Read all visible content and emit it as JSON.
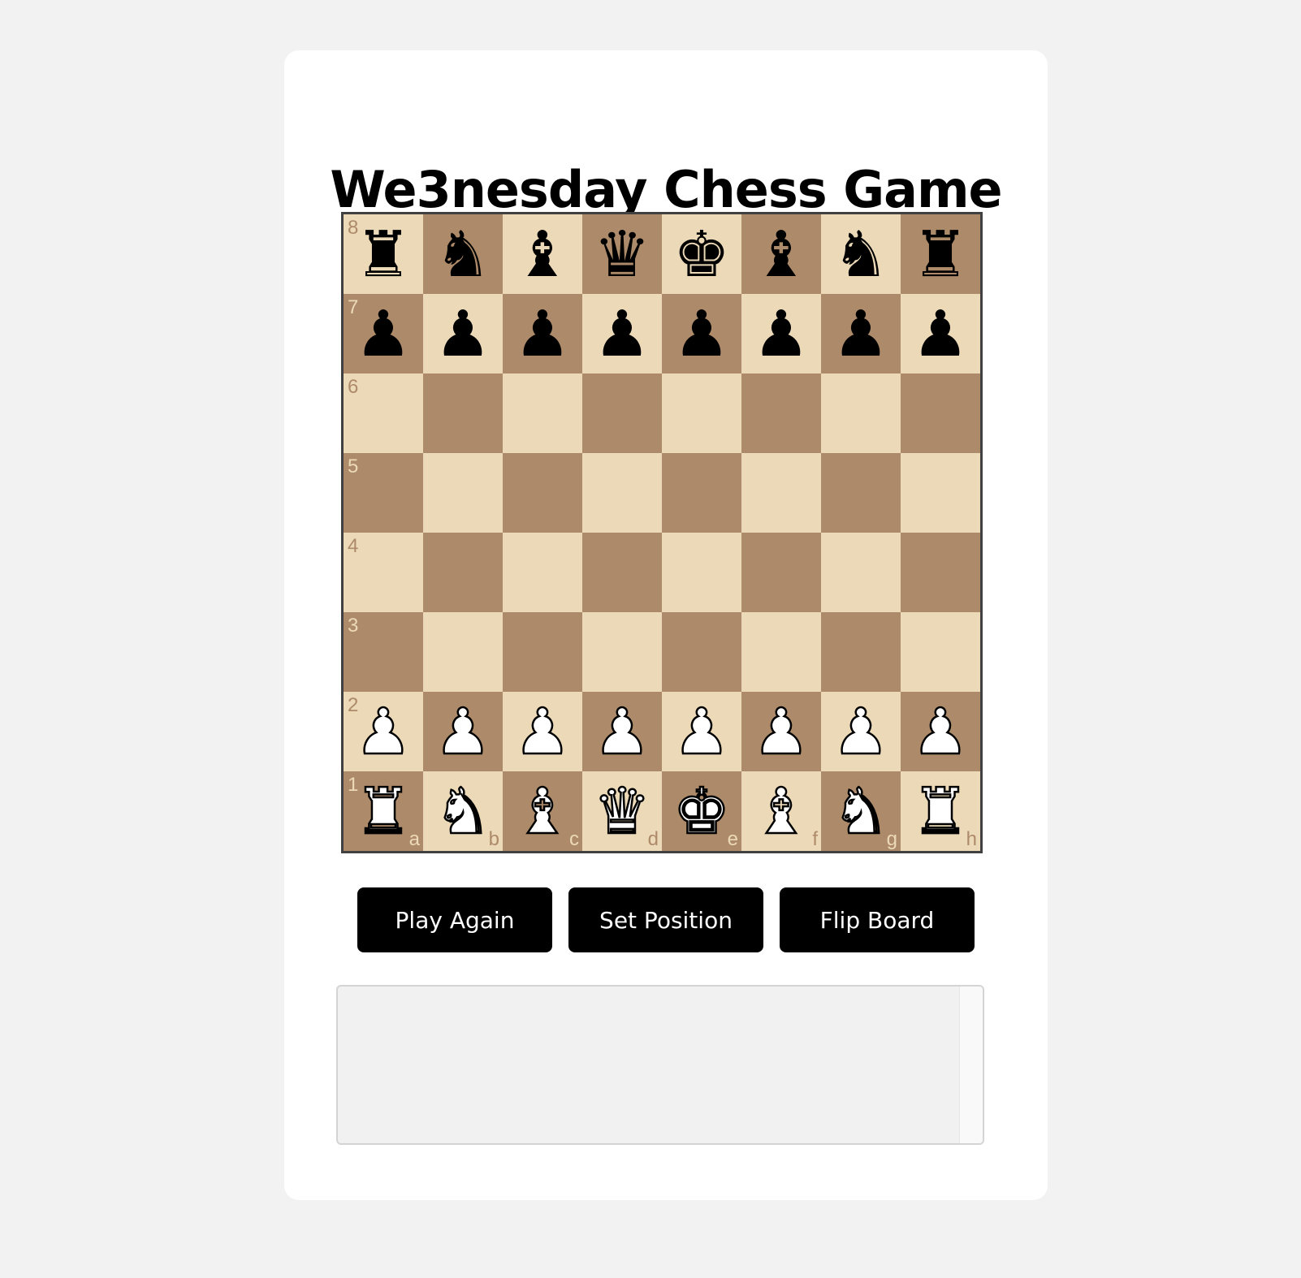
{
  "page": {
    "title": "We3nesday Chess Game"
  },
  "colors": {
    "light_square": "#ecd9b7",
    "dark_square": "#ad8a69",
    "button_bg": "#000000",
    "button_text": "#ffffff"
  },
  "board": {
    "files": [
      "a",
      "b",
      "c",
      "d",
      "e",
      "f",
      "g",
      "h"
    ],
    "ranks": [
      "8",
      "7",
      "6",
      "5",
      "4",
      "3",
      "2",
      "1"
    ],
    "position": [
      [
        "bR",
        "bN",
        "bB",
        "bQ",
        "bK",
        "bB",
        "bN",
        "bR"
      ],
      [
        "bP",
        "bP",
        "bP",
        "bP",
        "bP",
        "bP",
        "bP",
        "bP"
      ],
      [
        "",
        "",
        "",
        "",
        "",
        "",
        "",
        ""
      ],
      [
        "",
        "",
        "",
        "",
        "",
        "",
        "",
        ""
      ],
      [
        "",
        "",
        "",
        "",
        "",
        "",
        "",
        ""
      ],
      [
        "",
        "",
        "",
        "",
        "",
        "",
        "",
        ""
      ],
      [
        "wP",
        "wP",
        "wP",
        "wP",
        "wP",
        "wP",
        "wP",
        "wP"
      ],
      [
        "wR",
        "wN",
        "wB",
        "wQ",
        "wK",
        "wB",
        "wN",
        "wR"
      ]
    ],
    "piece_names": {
      "K": "king",
      "Q": "queen",
      "R": "rook",
      "B": "bishop",
      "N": "knight",
      "P": "pawn"
    },
    "piece_glyphs": {
      "K": "♚",
      "Q": "♛",
      "R": "♜",
      "B": "♝",
      "N": "♞",
      "P": "♟"
    }
  },
  "controls": {
    "play_again_label": "Play Again",
    "set_position_label": "Set Position",
    "flip_board_label": "Flip Board"
  },
  "move_log": {
    "value": ""
  }
}
